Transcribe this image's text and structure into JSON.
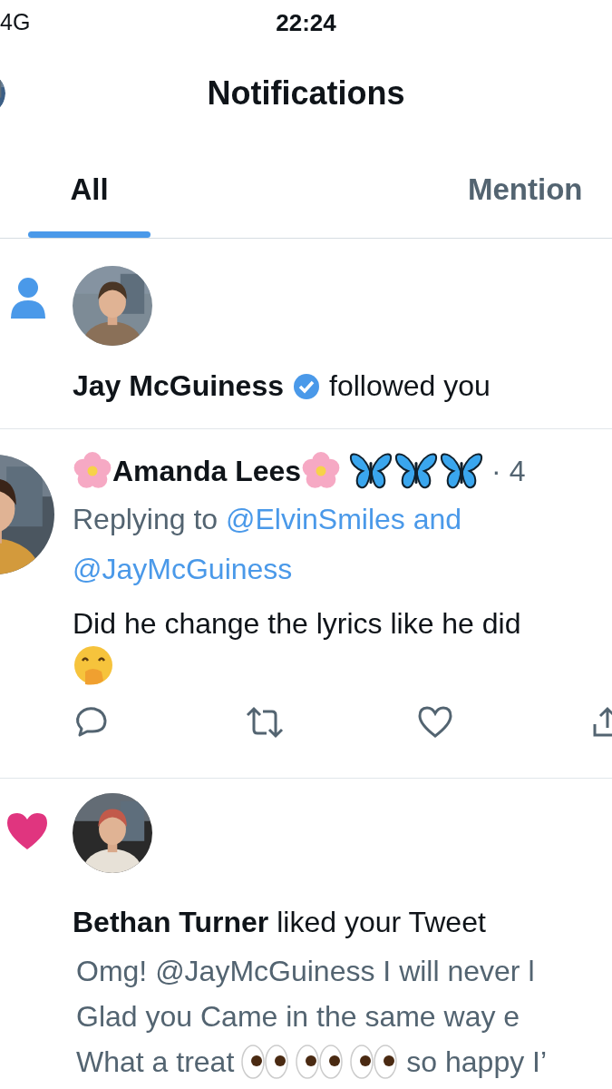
{
  "status_bar": {
    "network": "4G",
    "time": "22:24"
  },
  "header": {
    "title": "Notifications"
  },
  "tabs": [
    {
      "label": "All",
      "selected": true
    },
    {
      "label": "Mention",
      "selected": false
    }
  ],
  "notifications": [
    {
      "kind": "follow",
      "name": "Jay McGuiness",
      "verified": true,
      "action": "followed you"
    },
    {
      "kind": "reply",
      "name": "Amanda Lees",
      "time": "· 4",
      "replying_label": "Replying to",
      "mentions": [
        "@ElvinSmiles and",
        "@JayMcGuiness"
      ],
      "body": "Did he change the lyrics like he did"
    },
    {
      "kind": "like",
      "name": "Bethan Turner",
      "action": "liked your Tweet",
      "preview": [
        [
          {
            "kind": "text",
            "text": "Omg! @JayMcGuiness I will never l"
          }
        ],
        [
          {
            "kind": "text",
            "text": "Glad you Came in the same way e"
          }
        ],
        [
          {
            "kind": "text",
            "text": "What a treat"
          },
          {
            "kind": "eyes"
          },
          {
            "kind": "eyes"
          },
          {
            "kind": "eyes"
          },
          {
            "kind": "text",
            "text": "so happy I’"
          }
        ]
      ]
    }
  ]
}
